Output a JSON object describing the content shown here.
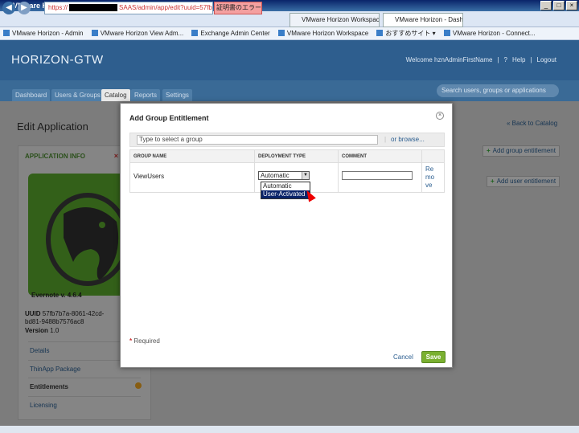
{
  "browser": {
    "window_title": "VMware Horizon - Dashboard - Windows Internet Explorer",
    "address_prefix": "https://",
    "address_suffix": "SAAS/admin/app/edit?uuid=57fb",
    "cert_error": "証明書のエラー",
    "tabs": [
      {
        "label": "VMware Horizon Workspace - ..."
      },
      {
        "label": "VMware Horizon - Dashboa..."
      }
    ],
    "favorites": [
      "VMware Horizon - Admin",
      "VMware Horizon View Adm...",
      "Exchange Admin Center",
      "VMware Horizon Workspace",
      "おすすめサイト ▾",
      "VMware Horizon - Connect..."
    ]
  },
  "app": {
    "brand": "HORIZON-GTW",
    "welcome": "Welcome hznAdminFirstName",
    "help": "Help",
    "logout": "Logout",
    "search_placeholder": "Search users, groups or applications",
    "nav_tabs": [
      "Dashboard",
      "Users & Groups",
      "Catalog",
      "Reports",
      "Settings"
    ]
  },
  "page": {
    "title": "Edit Application",
    "back_link": "« Back to Catalog",
    "add_group_button": "Add group entitlement",
    "add_user_button": "Add user entitlement",
    "info_header": "APPLICATION INFO",
    "app_name": "Evernote v. 4.6.4",
    "uuid_label": "UUID",
    "uuid_value": "57fb7b7a-8061-42cd-bd81-9488b7576ac8",
    "version_label": "Version",
    "version_value": "1.0",
    "side_nav": [
      "Details",
      "ThinApp Package",
      "Entitlements",
      "Licensing"
    ]
  },
  "modal": {
    "title": "Add Group Entitlement",
    "group_placeholder": "Type to select a group",
    "browse_link": "or browse...",
    "columns": [
      "GROUP NAME",
      "DEPLOYMENT TYPE",
      "COMMENT"
    ],
    "row": {
      "group_name": "ViewUsers",
      "deployment_selected": "Automatic",
      "remove_label": "Remove"
    },
    "dropdown_options": [
      "Automatic",
      "User-Activated"
    ],
    "required_note": "Required",
    "cancel": "Cancel",
    "save": "Save"
  },
  "colors": {
    "header_blue": "#2e5e8e",
    "save_green": "#7ab030",
    "logo_green": "#58a52c"
  }
}
